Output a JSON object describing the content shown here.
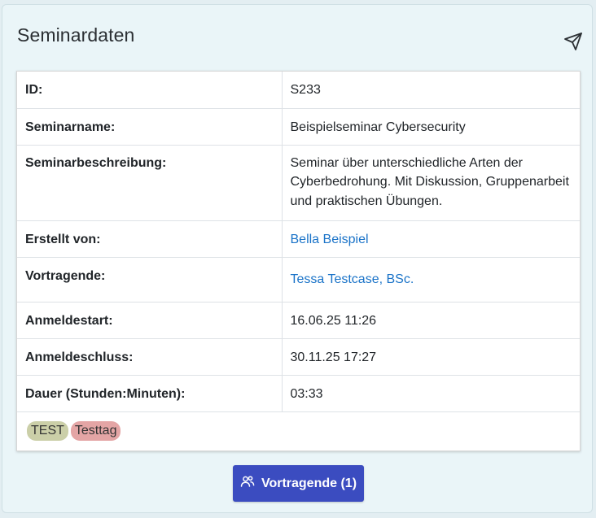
{
  "card": {
    "title": "Seminardaten",
    "send_icon": "send-icon"
  },
  "details": {
    "rows": [
      {
        "label": "ID:",
        "value": "S233"
      },
      {
        "label": "Seminarname:",
        "value": "Beispielseminar Cybersecurity"
      },
      {
        "label": "Seminarbeschreibung:",
        "value": "Seminar über unterschiedliche Arten der Cyberbedrohung. Mit Diskussion, Gruppenarbeit und praktischen Übungen."
      },
      {
        "label": "Erstellt von:",
        "value": "Bella Beispiel"
      },
      {
        "label": "Vortragende:",
        "value": "Tessa Testcase, BSc."
      },
      {
        "label": "Anmeldestart:",
        "value": "16.06.25 11:26"
      },
      {
        "label": "Anmeldeschluss:",
        "value": "30.11.25 17:27"
      },
      {
        "label": "Dauer (Stunden:Minuten):",
        "value": "03:33"
      }
    ]
  },
  "tags": [
    {
      "label": "TEST",
      "color": "#cbcfa8"
    },
    {
      "label": "Testtag",
      "color": "#e4a5a5"
    }
  ],
  "speakers_button": {
    "label": "Vortragende (1)",
    "icon": "users-icon"
  },
  "colors": {
    "accent": "#3b4cc0",
    "link": "#1a73c8",
    "background": "#eaf5f8"
  }
}
